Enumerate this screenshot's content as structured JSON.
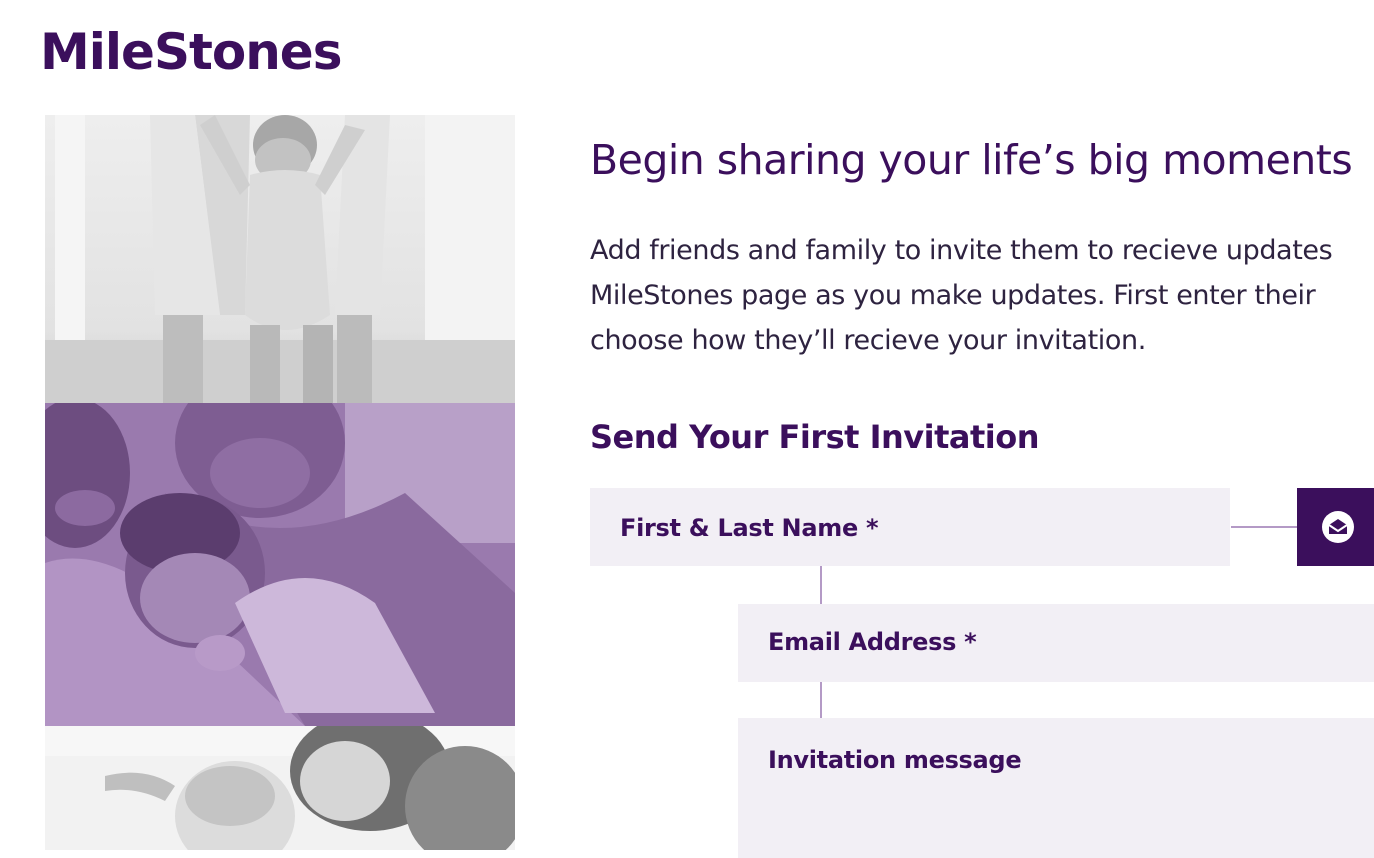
{
  "brand": {
    "logo_text": "MileStones",
    "color_primary": "#3b0f5c",
    "color_field_bg": "#f2eff5",
    "color_connector": "#b49ac6"
  },
  "photos": [
    {
      "icon": "photo-baby-walking",
      "tint": "grayscale"
    },
    {
      "icon": "photo-parents-with-newborn",
      "tint": "purple"
    },
    {
      "icon": "photo-mother-with-baby",
      "tint": "grayscale"
    }
  ],
  "main": {
    "headline": "Begin sharing your life’s big moments",
    "intro_lines": [
      "Add friends and family to invite them to recieve updates",
      "MileStones page as you make updates. First enter their",
      "choose how they’ll recieve your invitation."
    ],
    "section_title": "Send Your First Invitation"
  },
  "form": {
    "name_label": "First & Last Name *",
    "email_label": "Email Address *",
    "message_label": "Invitation message",
    "email_method_icon": "envelope-icon"
  }
}
